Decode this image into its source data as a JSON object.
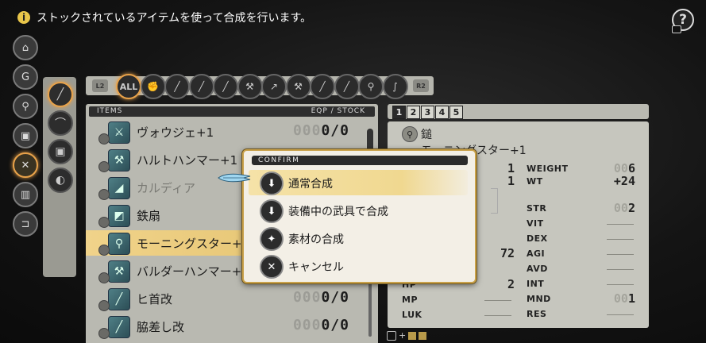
{
  "hint": {
    "text": "ストックされているアイテムを使って合成を行います。",
    "icon": "i"
  },
  "help": {
    "label": "?"
  },
  "left_menu": [
    {
      "name": "shop-icon",
      "glyph": "⌂"
    },
    {
      "name": "bag-icon",
      "glyph": "G"
    },
    {
      "name": "search-icon",
      "glyph": "⚲"
    },
    {
      "name": "chest-icon",
      "glyph": "▣"
    },
    {
      "name": "synthesis-icon",
      "glyph": "✕",
      "active": true
    },
    {
      "name": "bars-icon",
      "glyph": "▥"
    },
    {
      "name": "exit-icon",
      "glyph": "⊐"
    }
  ],
  "categories": [
    {
      "name": "sword-category-icon",
      "glyph": "╱",
      "active": true
    },
    {
      "name": "bow-category-icon",
      "glyph": "⌒"
    },
    {
      "name": "armor-category-icon",
      "glyph": "▣"
    },
    {
      "name": "accessory-category-icon",
      "glyph": "◐"
    }
  ],
  "filter": {
    "left_tag": "L2",
    "right_tag": "R2",
    "icons": [
      {
        "name": "filter-all",
        "glyph": "ALL",
        "active": true
      },
      {
        "name": "filter-fist-icon",
        "glyph": "✊"
      },
      {
        "name": "filter-dagger-icon",
        "glyph": "╱"
      },
      {
        "name": "filter-sword-icon",
        "glyph": "╱"
      },
      {
        "name": "filter-katana-icon",
        "glyph": "╱"
      },
      {
        "name": "filter-axe-icon",
        "glyph": "⚒"
      },
      {
        "name": "filter-spear-icon",
        "glyph": "↗"
      },
      {
        "name": "filter-hammer-icon",
        "glyph": "⚒"
      },
      {
        "name": "filter-staff-icon",
        "glyph": "╱"
      },
      {
        "name": "filter-rod-icon",
        "glyph": "╱"
      },
      {
        "name": "filter-mace-icon",
        "glyph": "⚲"
      },
      {
        "name": "filter-whip-icon",
        "glyph": "∫"
      }
    ]
  },
  "items_panel": {
    "header_left": "ITEMS",
    "header_right": "EQP / STOCK",
    "rows": [
      {
        "name": "ヴォウジェ+1",
        "stock_ghost": "000",
        "stock": "0/",
        "stock_end": "0",
        "glyph": "⚔"
      },
      {
        "name": "ハルトハンマー+1",
        "stock_ghost": "",
        "stock": "",
        "stock_end": "",
        "glyph": "⚒"
      },
      {
        "name": "カルディア",
        "stock_ghost": "",
        "stock": "",
        "stock_end": "",
        "glyph": "◢",
        "dim": true
      },
      {
        "name": "鉄扇",
        "stock_ghost": "",
        "stock": "",
        "stock_end": "",
        "glyph": "◩"
      },
      {
        "name": "モーニングスター+1",
        "stock_ghost": "",
        "stock": "",
        "stock_end": "",
        "glyph": "⚲",
        "selected": true
      },
      {
        "name": "バルダーハンマー+1",
        "stock_ghost": "",
        "stock": "",
        "stock_end": "",
        "glyph": "⚒"
      },
      {
        "name": "ヒ首改",
        "stock_ghost": "000",
        "stock": "0/",
        "stock_end": "0",
        "glyph": "╱"
      },
      {
        "name": "脇差し改",
        "stock_ghost": "000",
        "stock": "0/",
        "stock_end": "0",
        "glyph": "╱"
      }
    ]
  },
  "tabs": [
    "1",
    "2",
    "3",
    "4",
    "5"
  ],
  "detail": {
    "type_label": "鎚",
    "item_name": "モーニングスター+1",
    "left_values": [
      "1",
      "1",
      "72",
      "2"
    ],
    "stats_right": [
      {
        "k": "WEIGHT",
        "ghost": "00",
        "v": "6"
      },
      {
        "k": "WT",
        "ghost": "",
        "v": "+24"
      },
      {
        "k": "STR",
        "ghost": "00",
        "v": "2"
      },
      {
        "k": "VIT",
        "ghost": "",
        "v": ""
      },
      {
        "k": "DEX",
        "ghost": "",
        "v": ""
      },
      {
        "k": "AGI",
        "ghost": "",
        "v": ""
      },
      {
        "k": "AVD",
        "ghost": "",
        "v": ""
      },
      {
        "k": "INT",
        "ghost": "",
        "v": ""
      },
      {
        "k": "MND",
        "ghost": "00",
        "v": "1"
      },
      {
        "k": "RES",
        "ghost": "",
        "v": ""
      }
    ],
    "stats_left": [
      {
        "k": "HP"
      },
      {
        "k": "MP"
      },
      {
        "k": "LUK"
      }
    ]
  },
  "confirm": {
    "title": "CONFIRM",
    "options": [
      {
        "label": "通常合成",
        "glyph": "⬇",
        "selected": true
      },
      {
        "label": "装備中の武具で合成",
        "glyph": "⬇"
      },
      {
        "label": "素材の合成",
        "glyph": "✦"
      },
      {
        "label": "キャンセル",
        "glyph": "✕"
      }
    ]
  },
  "colors": {
    "accent": "#e8a24a",
    "panel": "#b9b9b1",
    "dialog_border": "#c9a14a"
  }
}
